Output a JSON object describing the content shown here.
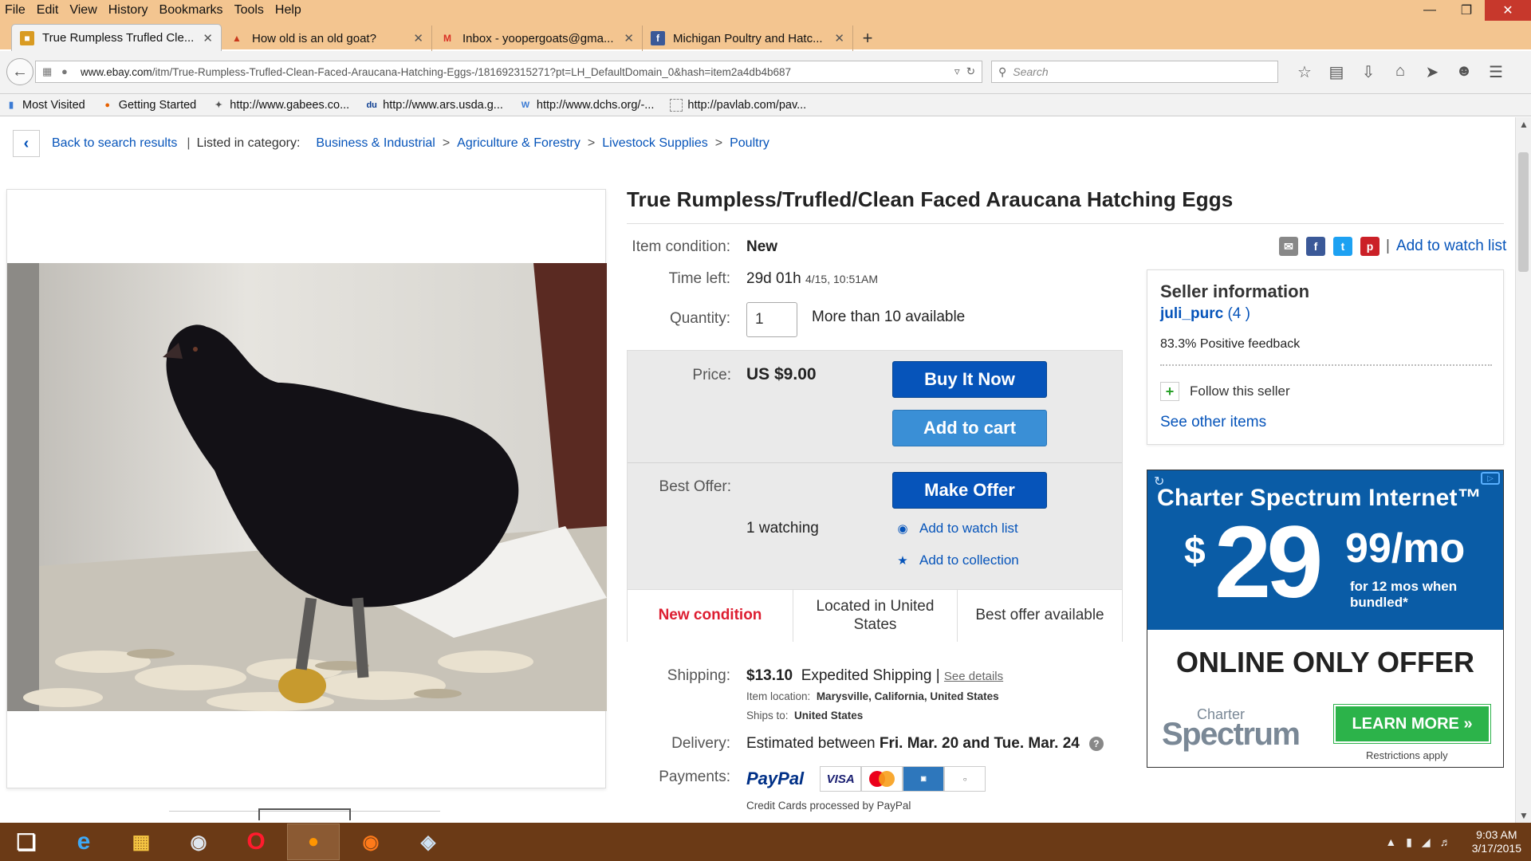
{
  "browser": {
    "menu": [
      "File",
      "Edit",
      "View",
      "History",
      "Bookmarks",
      "Tools",
      "Help"
    ],
    "tabs": [
      {
        "label": "True Rumpless Trufled Cle...",
        "active": true
      },
      {
        "label": "How old is an old goat?"
      },
      {
        "label": "Inbox - yoopergoats@gma..."
      },
      {
        "label": "Michigan Poultry and Hatc..."
      }
    ],
    "url_domain": "www.ebay.com",
    "url_path": "/itm/True-Rumpless-Trufled-Clean-Faced-Araucana-Hatching-Eggs-/181692315271?pt=LH_DefaultDomain_0&hash=item2a4db4b687",
    "search_placeholder": "Search",
    "bookmarks": [
      "Most Visited",
      "Getting Started",
      "http://www.gabees.co...",
      "http://www.ars.usda.g...",
      "http://www.dchs.org/-...",
      "http://pavlab.com/pav..."
    ]
  },
  "breadcrumb": {
    "back": "Back to search results",
    "listed": "Listed in category:",
    "items": [
      "Business & Industrial",
      "Agriculture & Forestry",
      "Livestock Supplies",
      "Poultry"
    ]
  },
  "item": {
    "title": "True Rumpless/Trufled/Clean Faced Araucana Hatching Eggs",
    "condition_label": "Item condition:",
    "condition": "New",
    "time_label": "Time left:",
    "time_left": "29d 01h",
    "time_end": "4/15, 10:51AM",
    "qty_label": "Quantity:",
    "qty_value": "1",
    "qty_avail": "More than 10 available",
    "price_label": "Price:",
    "price": "US $9.00",
    "buy_now": "Buy It Now",
    "add_cart": "Add to cart",
    "offer_label": "Best Offer:",
    "make_offer": "Make Offer",
    "watching": "1 watching",
    "add_watch": "Add to watch list",
    "add_collection": "Add to collection",
    "highlights": [
      "New condition",
      "Located in United States",
      "Best offer available"
    ],
    "shipping_label": "Shipping:",
    "shipping_cost": "$13.10",
    "shipping_type": "Expedited Shipping |",
    "see_details": "See details",
    "item_location_label": "Item location:",
    "item_location": "Marysville, California, United States",
    "ships_to_label": "Ships to:",
    "ships_to": "United States",
    "delivery_label": "Delivery:",
    "delivery_pre": "Estimated between",
    "delivery_dates": "Fri. Mar. 20 and Tue. Mar. 24",
    "payments_label": "Payments:",
    "paypal": "PayPal",
    "cards": [
      "VISA",
      "MC",
      "AMEX",
      "DISCOVER"
    ],
    "cc_note": "Credit Cards processed by PayPal"
  },
  "share": {
    "watch": "Add to watch list"
  },
  "seller": {
    "heading": "Seller information",
    "name": "juli_purc",
    "score": "(4 )",
    "feedback": "83.3% Positive feedback",
    "follow": "Follow this seller",
    "other": "See other items"
  },
  "ad": {
    "headline": "Charter Spectrum Internet™",
    "dollar": "$",
    "dollars": "29",
    "cents": "99/mo",
    "fine": "for 12 mos when bundled*",
    "offer": "ONLINE ONLY OFFER",
    "brand_small": "Charter",
    "brand": "Spectrum",
    "cta": "LEARN MORE »",
    "restrictions": "Restrictions apply"
  },
  "taskbar": {
    "time": "9:03 AM",
    "date": "3/17/2015"
  },
  "colors": {
    "ebay_link": "#0654ba",
    "buy_button": "#0654ba",
    "cart_button": "#3a8fd6",
    "new_condition": "#dd1e31",
    "titlebar": "#f3c590",
    "taskbar": "#6b3a16",
    "ad_blue": "#0a5ca6",
    "ad_green": "#2cb34a"
  }
}
